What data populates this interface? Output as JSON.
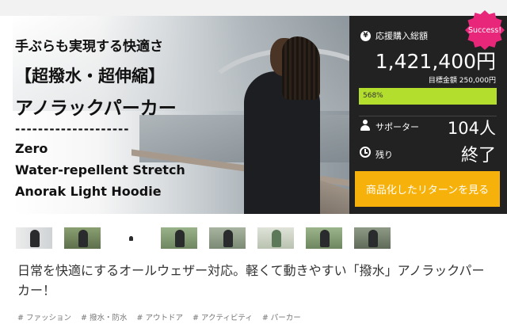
{
  "hero": {
    "title_lines": [
      "手ぶらも実現する快適さ",
      "【超撥水・超伸縮】",
      "アノラックパーカー",
      "--------------------",
      "Zero",
      "Water-repellent Stretch",
      "Anorak Light Hoodie"
    ]
  },
  "badge": {
    "label": "Success!",
    "color": "#e8267a"
  },
  "funding": {
    "total_icon": "yen-coin-icon",
    "total_label": "応援購入総額",
    "total_amount": "1,421,400円",
    "goal_text": "目標金額 250,000円",
    "progress_percent": 568,
    "progress_text": "568%",
    "supporters_icon": "person-icon",
    "supporters_label": "サポーター",
    "supporters_count": "104人",
    "remaining_icon": "clock-icon",
    "remaining_label": "残り",
    "remaining_value": "終了",
    "cta_label": "商品化したリターンを見る",
    "accent_color": "#f7b10b",
    "progress_color": "#b4de2d"
  },
  "thumbnails_count": 8,
  "description": "日常を快適にするオールウェザー対応。軽くて動きやすい「撥水」アノラックパーカー！",
  "tags": [
    "# ファッション",
    "# 撥水・防水",
    "# アウトドア",
    "# アクティビティ",
    "# パーカー"
  ]
}
